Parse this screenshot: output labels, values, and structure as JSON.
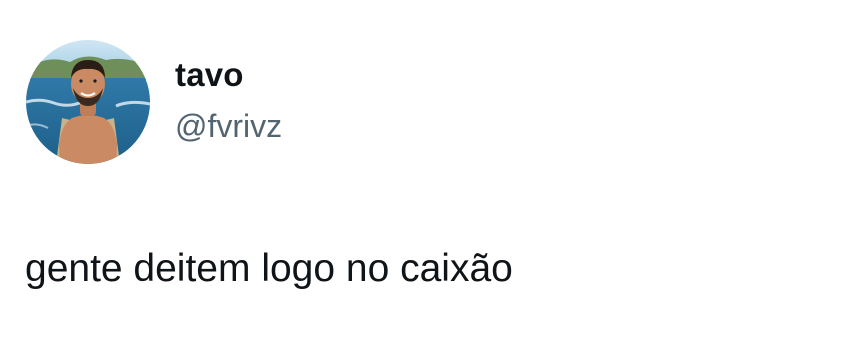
{
  "tweet": {
    "author": {
      "display_name": "tavo",
      "handle": "@fvrivz",
      "avatar_icon": "profile-photo-icon"
    },
    "text": "gente deitem logo no caixão"
  },
  "colors": {
    "background": "#ffffff",
    "text_primary": "#0f1419",
    "text_secondary": "#536471"
  }
}
